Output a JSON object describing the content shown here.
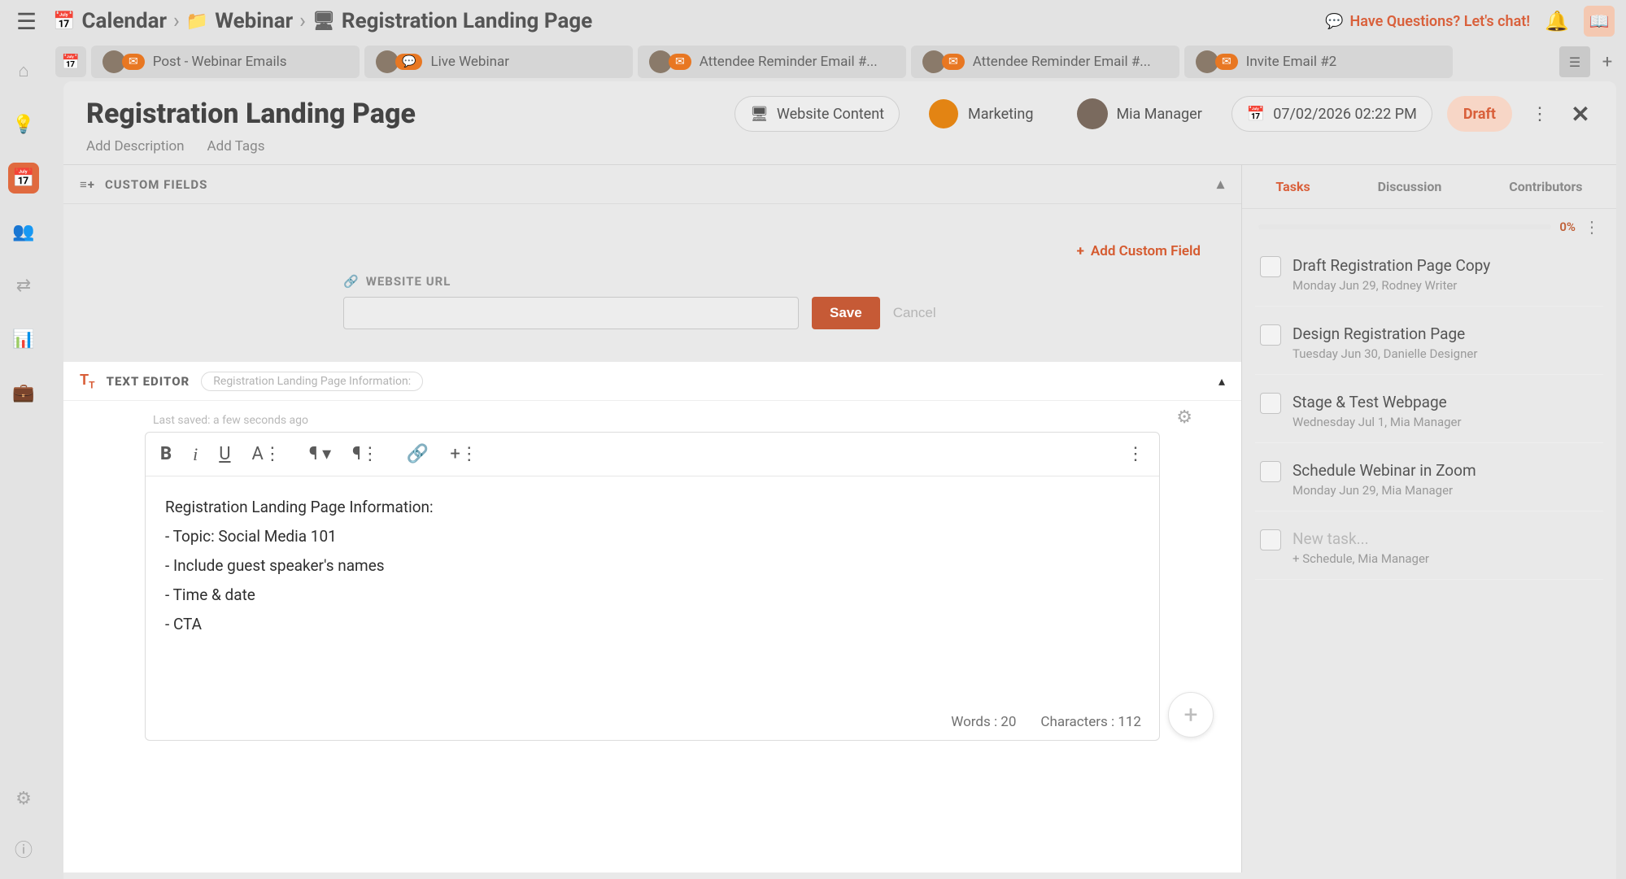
{
  "breadcrumb": {
    "root": "Calendar",
    "folder": "Webinar",
    "page": "Registration Landing Page"
  },
  "topbar": {
    "questions": "Have Questions? Let's chat!"
  },
  "tabs": [
    {
      "label": "Post - Webinar Emails"
    },
    {
      "label": "Live Webinar"
    },
    {
      "label": "Attendee Reminder Email #..."
    },
    {
      "label": "Attendee Reminder Email #..."
    },
    {
      "label": "Invite Email #2"
    }
  ],
  "page": {
    "title": "Registration Landing Page",
    "add_description": "Add Description",
    "add_tags": "Add Tags",
    "content_type": "Website Content",
    "calendar_group": "Marketing",
    "assignee": "Mia Manager",
    "datetime": "07/02/2026 02:22 PM",
    "status": "Draft"
  },
  "custom_fields": {
    "heading": "CUSTOM FIELDS",
    "add_label": "Add Custom Field",
    "url_label": "WEBSITE URL",
    "url_value": "",
    "save": "Save",
    "cancel": "Cancel"
  },
  "editor": {
    "heading": "TEXT EDITOR",
    "pill": "Registration Landing Page Information:",
    "last_saved": "Last saved: a few seconds ago",
    "content_lines": [
      "Registration Landing Page Information:",
      "- Topic: Social Media 101",
      "- Include guest speaker's names",
      "- Time & date",
      "- CTA"
    ],
    "words_label": "Words : ",
    "words": "20",
    "chars_label": "Characters : ",
    "chars": "112"
  },
  "right": {
    "tabs": {
      "tasks": "Tasks",
      "discussion": "Discussion",
      "contributors": "Contributors"
    },
    "progress_pct": "0%",
    "tasks": [
      {
        "name": "Draft Registration Page Copy",
        "date": "Monday Jun 29,",
        "who": "Rodney Writer"
      },
      {
        "name": "Design Registration Page",
        "date": "Tuesday Jun 30,",
        "who": "Danielle Designer"
      },
      {
        "name": "Stage & Test Webpage",
        "date": "Wednesday Jul 1,",
        "who": "Mia Manager"
      },
      {
        "name": "Schedule Webinar in Zoom",
        "date": "Monday Jun 29,",
        "who": "Mia Manager"
      }
    ],
    "new_task": {
      "placeholder": "New task...",
      "schedule": "+ Schedule,",
      "who": "Mia Manager"
    }
  }
}
